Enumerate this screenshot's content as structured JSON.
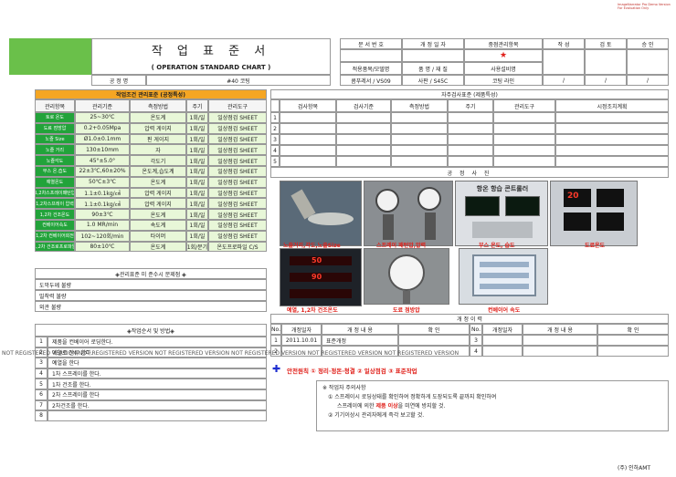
{
  "corner_note": [
    "ImageNarrator Pro Demo Version",
    "For Evaluation Only"
  ],
  "header": {
    "title": "작 업 표 준 서",
    "subtitle": "( OPERATION STANDARD CHART )",
    "process_label": "공 정 명",
    "process_value": "#40  코팅",
    "doc_no_label": "문 서 번 호",
    "rev_date_label": "개 정 일 자",
    "key_item_label": "중점관리항목",
    "star": "★",
    "approvals": [
      "작 성",
      "검 토",
      "승 인"
    ],
    "applied_model_label": "적용품목/모델명",
    "part_material_label": "품 명 / 재 질",
    "equipment_label": "사용설비명",
    "applied_model": "콤푸레서  /  VS09",
    "part_material": "사판  /  S45C",
    "equipment": "코팅 라인",
    "approval_slashes": [
      "/",
      "/",
      "/"
    ]
  },
  "conditions": {
    "section_title": "작업조건 관리표준 (공정특성)",
    "columns": [
      "관리항목",
      "관리기준",
      "측정방법",
      "주기",
      "관리도구"
    ],
    "rows": [
      [
        "토로 온도",
        "25~30℃",
        "온도계",
        "1회/일",
        "일상점검 SHEET"
      ],
      [
        "도료 점방압",
        "0.2+0.05Mpa",
        "압력 게이지",
        "1회/일",
        "일상점검 SHEET"
      ],
      [
        "노즐 Size",
        "Ø1.0±0.1mm",
        "핀 게이지",
        "1회/일",
        "일상점검 SHEET"
      ],
      [
        "노즐 거리",
        "130±10mm",
        "자",
        "1회/일",
        "일상점검 SHEET"
      ],
      [
        "노즐각도",
        "45°±5.0°",
        "각도기",
        "1회/일",
        "일상점검 SHEET"
      ],
      [
        "부스 온.습도",
        "22±3℃,60±20%",
        "온도계,습도계",
        "1회/일",
        "일상점검 SHEET"
      ],
      [
        "예열온도",
        "50℃±3℃",
        "온도계",
        "1회/일",
        "일상점검 SHEET"
      ],
      [
        "1,2차스프레이패턴압",
        "1.1±0.1kg/㎠",
        "압력 게이지",
        "1회/일",
        "일상점검 SHEET"
      ],
      [
        "1,2차스프레이 압력",
        "1.1±0.1kg/㎠",
        "압력 게이지",
        "1회/일",
        "일상점검 SHEET"
      ],
      [
        "1,2차 건조온도",
        "90±3℃",
        "온도계",
        "1회/일",
        "일상점검 SHEET"
      ],
      [
        "컨베이어속도",
        "1.0 MR/min",
        "속도계",
        "1회/일",
        "일상점검 SHEET"
      ],
      [
        "1,2차 컨베이어회전",
        "102~120회/min",
        "타이머",
        "1회/일",
        "일상점검 SHEET"
      ],
      [
        "1,2차 건조로프로파일",
        "80±10℃",
        "온도계",
        "1회/분기",
        "온도프로파일 C/S"
      ]
    ]
  },
  "self_check": {
    "section_title": "자주검사표준 (제품특성)",
    "columns": [
      "검사항목",
      "검사기준",
      "측정방법",
      "주기",
      "관리도구",
      "시정조치계획"
    ],
    "row_numbers": [
      "1",
      "2",
      "3",
      "4",
      "5"
    ]
  },
  "problems": {
    "section_title": "◈관리표준 미 준수시 문제점 ◈",
    "items": [
      "도막두께 불량",
      "밀착력 불량",
      "외관 불량"
    ]
  },
  "procedure": {
    "section_title": "◈작업순서 및 방법◈",
    "steps": [
      {
        "no": "1",
        "text": "제품을 컨베이어 로딩한다."
      },
      {
        "no": "2",
        "text": "예열로 잔류 한다."
      },
      {
        "no": "3",
        "text": "예열을 한다"
      },
      {
        "no": "4",
        "text": "1차 스프레이를 한다."
      },
      {
        "no": "5",
        "text": "1차 건조를 한다."
      },
      {
        "no": "6",
        "text": "2차 스프레이를 한다"
      },
      {
        "no": "7",
        "text": "2차건조를 한다."
      },
      {
        "no": "8",
        "text": ""
      }
    ]
  },
  "photos": {
    "section_title": "공 정 사 진",
    "captions": [
      "노즐거리,각도,노즐Size",
      "스프레이 패턴압,압력",
      "부스 온도, 습도",
      "도료온도",
      "예열, 1,2차 건조온도",
      "도료 점방압",
      "컨베이어 속도"
    ],
    "panel_text": "항온 항습 콘트롤러",
    "digit_a": "20",
    "digit_b": "50",
    "digit_c": "90"
  },
  "history": {
    "section_title": "개  정  이  력",
    "columns": [
      "No.",
      "개정일자",
      "개 정 내 용",
      "확 인"
    ],
    "left_rows": [
      [
        "1",
        "2011.10.01",
        "표준개정",
        ""
      ],
      [
        "2",
        "",
        "",
        ""
      ]
    ],
    "right_rows": [
      [
        "3",
        "",
        "",
        ""
      ],
      [
        "4",
        "",
        "",
        ""
      ]
    ]
  },
  "safety": {
    "cross": "✚",
    "text": "안전원칙  ① 정리·정돈·청결  ② 일상점검  ③ 표준작업"
  },
  "notes": {
    "title": "※ 작업자 주의사항",
    "line1": "① 스프레이시 로딩상태를 확인하여 정확하게 도장되도록 끝까지 확인하여",
    "line2_pre": "스프레이에 의한 ",
    "line2_em": "제품 이상",
    "line2_post": "을 미연에 방지할 것.",
    "line3": "② 기기이상시 관리자에게 즉각 보고할 것."
  },
  "watermark": "NOT REGISTERED VERSION NOT REGISTERED VERSION NOT REGISTERED VERSION NOT REGISTERED VERSION NOT REGISTERED VERSION NOT REGISTERED VERSION",
  "footer": "(주) 인하AMT"
}
